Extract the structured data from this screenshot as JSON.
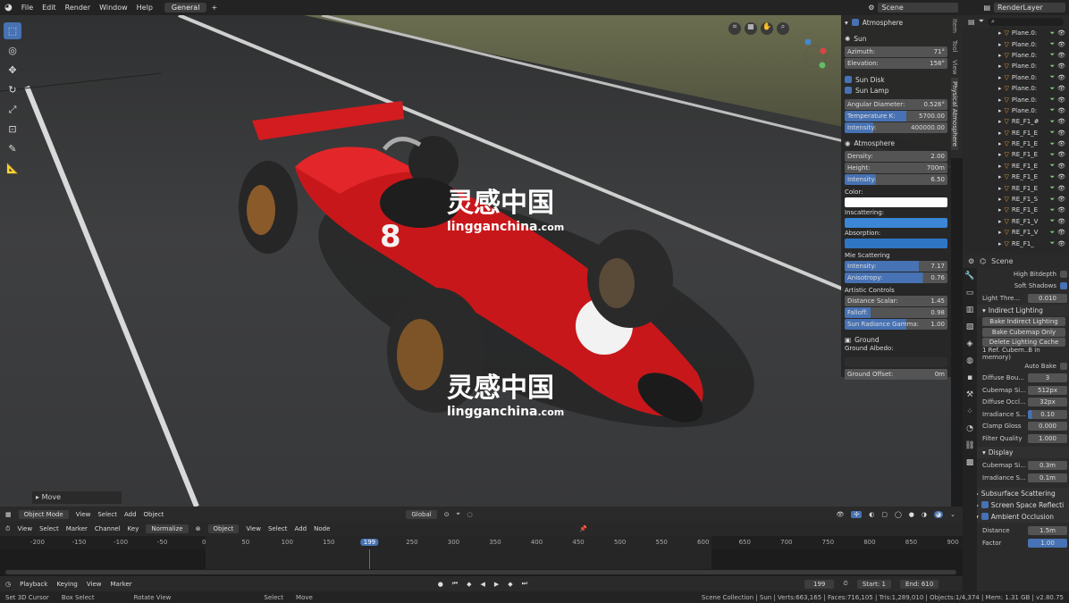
{
  "topbar": {
    "menus": [
      "File",
      "Edit",
      "Render",
      "Window",
      "Help"
    ],
    "workspace_tab": "General",
    "add_tab": "+",
    "scene_label": "Scene",
    "render_layer": "RenderLayer"
  },
  "viewport": {
    "last_op": "Move",
    "mode": "Object Mode",
    "header_menus": [
      "View",
      "Select",
      "Add",
      "Object"
    ],
    "transform_orient": "Global"
  },
  "watermark": {
    "brand_cn": "灵感中国",
    "brand_url": "lingganchina",
    "brand_tld": ".com"
  },
  "car_number": "8",
  "sidebar_tabs": [
    "Item",
    "Tool",
    "View",
    "Physical Atmosphere"
  ],
  "atmosphere": {
    "title": "Atmosphere",
    "sun_title": "Sun",
    "azimuth_label": "Azimuth:",
    "azimuth": "71°",
    "elevation_label": "Elevation:",
    "elevation": "158°",
    "sun_disk": "Sun Disk",
    "sun_lamp": "Sun Lamp",
    "angular_label": "Angular Diameter:",
    "angular": "0.526°",
    "temp_label": "Temperature K:",
    "temp": "5700.00",
    "sun_int_label": "Intensity:",
    "sun_int": "400000.00",
    "atm_title": "Atmosphere",
    "density_label": "Density:",
    "density": "2.00",
    "height_label": "Height:",
    "height": "700m",
    "atm_int_label": "Intensity:",
    "atm_int": "6.50",
    "color_label": "Color:",
    "inscatter_label": "Inscattering:",
    "absorption_label": "Absorption:",
    "mie_title": "Mie Scattering",
    "mie_int_label": "Intensity:",
    "mie_int": "7.17",
    "aniso_label": "Anisotropy:",
    "aniso": "0.76",
    "artistic_title": "Artistic Controls",
    "dist_label": "Distance Scalar:",
    "dist": "1.45",
    "falloff_label": "Falloff:",
    "falloff": "0.98",
    "radiance_label": "Sun Radiance Gamma:",
    "radiance": "1.00",
    "ground_title": "Ground",
    "albedo_label": "Ground Albedo:",
    "offset_label": "Ground Offset:",
    "offset": "0m",
    "colors": {
      "white": "#ffffff",
      "inscatter": "#3b86d6",
      "absorption": "#2f76c4"
    }
  },
  "outliner": {
    "items": [
      "Plane.0:",
      "Plane.0:",
      "Plane.0:",
      "Plane.0:",
      "Plane.0:",
      "Plane.0:",
      "Plane.0:",
      "Plane.0:",
      "RE_F1_#",
      "RE_F1_E",
      "RE_F1_E",
      "RE_F1_E",
      "RE_F1_E",
      "RE_F1_E",
      "RE_F1_E",
      "RE_F1_S",
      "RE_F1_E",
      "RE_F1_V",
      "RE_F1_V",
      "RE_F1_"
    ]
  },
  "properties": {
    "scene": "Scene",
    "high_bitdepth": "High Bitdepth",
    "soft_shadows": "Soft Shadows",
    "light_thresh_label": "Light Thre...",
    "light_thresh": "0.010",
    "indirect_title": "Indirect Lighting",
    "bake_indirect": "Bake Indirect Lighting",
    "bake_cubemap": "Bake Cubemap Only",
    "delete_cache": "Delete Lighting Cache",
    "cache_info": "1 Ref. Cubem..B in memory)",
    "auto_bake": "Auto Bake",
    "diffuse_bou_label": "Diffuse Bou...",
    "diffuse_bou": "3",
    "cubemap_size_label": "Cubemap Si...",
    "cubemap_size": "512px",
    "diffuse_occl_label": "Diffuse Occl...",
    "diffuse_occl": "32px",
    "irradiance_label": "Irradiance S...",
    "irradiance": "0.10",
    "clamp_label": "Clamp Gloss",
    "clamp": "0.000",
    "filter_label": "Filter Quality",
    "filter": "1.000",
    "display_title": "Display",
    "disp_cubemap_label": "Cubemap Si...",
    "disp_cubemap": "0.3m",
    "disp_irr_label": "Irradiance S...",
    "disp_irr": "0.1m",
    "sss": "Subsurface Scattering",
    "ssr": "Screen Space Reflecti",
    "ao": "Ambient Occlusion",
    "distance_label": "Distance",
    "distance": "1.5m",
    "factor_label": "Factor",
    "factor": "1.00"
  },
  "timeline": {
    "menus": [
      "View",
      "Select",
      "Marker",
      "Channel",
      "Key"
    ],
    "normalize": "Normalize",
    "object": "Object",
    "menus2": [
      "View",
      "Select",
      "Add",
      "Node"
    ],
    "ticks": [
      "-200",
      "-150",
      "-100",
      "-50",
      "0",
      "50",
      "100",
      "150",
      "199",
      "250",
      "300",
      "350",
      "400",
      "450",
      "500",
      "550",
      "600",
      "650",
      "700",
      "750",
      "800",
      "850",
      "900"
    ],
    "current": "199",
    "playback_menus": [
      "Playback",
      "Keying",
      "View",
      "Marker"
    ],
    "frame": "199",
    "start_label": "Start:",
    "start": "1",
    "end_label": "End:",
    "end": "610"
  },
  "status": {
    "left": [
      "Set 3D Cursor",
      "Box Select",
      "Rotate View",
      "Select",
      "Move"
    ],
    "right": "Scene Collection | Sun | Verts:663,165 | Faces:716,105 | Tris:1,289,010 | Objects:1/4,374 | Mem: 1.31 GB | v2.80.75"
  }
}
